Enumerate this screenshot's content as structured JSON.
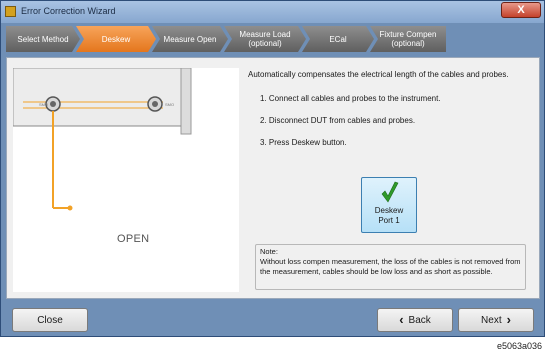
{
  "window": {
    "title": "Error Correction Wizard",
    "close_label": "X"
  },
  "steps": [
    {
      "label": "Select Method"
    },
    {
      "label": "Deskew",
      "active": true
    },
    {
      "label": "Measure Open"
    },
    {
      "label": "Measure Load (optional)"
    },
    {
      "label": "ECal"
    },
    {
      "label": "Fixture Compen (optional)"
    }
  ],
  "illustration": {
    "port_labels": [
      "SMO",
      "SMO"
    ],
    "open_label": "OPEN"
  },
  "instructions": {
    "intro": "Automatically compensates the electrical length of the cables and probes.",
    "items": [
      "1. Connect all cables and probes to the instrument.",
      "2. Disconnect DUT from cables and probes.",
      "3. Press Deskew button."
    ]
  },
  "deskew_button": {
    "line1": "Deskew",
    "line2": "Port 1",
    "icon": "checkmark-icon"
  },
  "note": {
    "title": "Note:",
    "text": "Without loss compen measurement, the loss of the cables is not removed from the measurement, cables should be low loss and as short as possible."
  },
  "footer": {
    "close_label": "Close",
    "back_label": "Back",
    "next_label": "Next"
  },
  "caption": "e5063a036",
  "colors": {
    "active_step": "#f08a35",
    "inactive_step": "#7a7a7a",
    "accent_button": "#bfe5f8",
    "check": "#2f9a2a",
    "trace": "#f2a227"
  }
}
